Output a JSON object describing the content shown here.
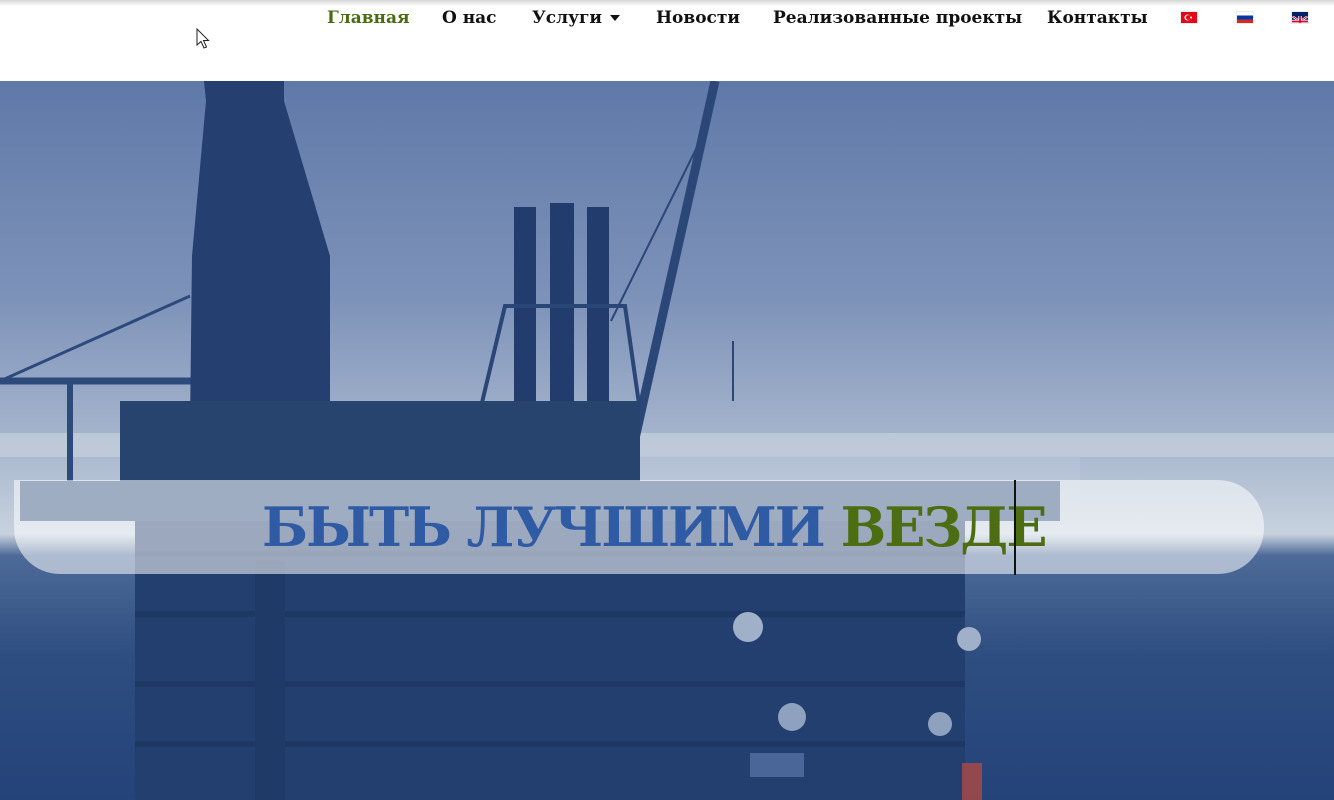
{
  "nav": {
    "items": [
      {
        "label": "Главная",
        "active": true
      },
      {
        "label": "О нас"
      },
      {
        "label": "Услуги",
        "has_dropdown": true
      },
      {
        "label": "Новости"
      },
      {
        "label": "Реализованные проекты"
      },
      {
        "label": "Контакты"
      }
    ],
    "languages": [
      "turkish-flag-icon",
      "russian-flag-icon",
      "uk-flag-icon"
    ]
  },
  "hero": {
    "headline_part1": "БЫТЬ ЛУЧШИМИ",
    "headline_part2": "ВЕЗДЕ"
  },
  "colors": {
    "nav_active": "#4a6b12",
    "headline_blue": "#2f5aa4",
    "headline_green": "#4d6d12"
  }
}
